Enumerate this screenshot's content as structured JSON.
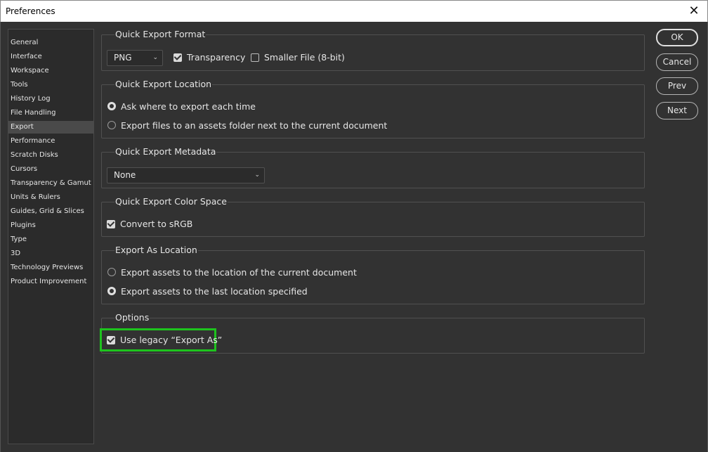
{
  "window": {
    "title": "Preferences",
    "close_glyph": "✕"
  },
  "sidebar": {
    "items": [
      {
        "label": "General"
      },
      {
        "label": "Interface"
      },
      {
        "label": "Workspace"
      },
      {
        "label": "Tools"
      },
      {
        "label": "History Log"
      },
      {
        "label": "File Handling"
      },
      {
        "label": "Export"
      },
      {
        "label": "Performance"
      },
      {
        "label": "Scratch Disks"
      },
      {
        "label": "Cursors"
      },
      {
        "label": "Transparency & Gamut"
      },
      {
        "label": "Units & Rulers"
      },
      {
        "label": "Guides, Grid & Slices"
      },
      {
        "label": "Plugins"
      },
      {
        "label": "Type"
      },
      {
        "label": "3D"
      },
      {
        "label": "Technology Previews"
      },
      {
        "label": "Product Improvement"
      }
    ],
    "active": "Export"
  },
  "quick_export_format": {
    "label": "Quick Export Format",
    "format": "PNG",
    "transparency_label": "Transparency",
    "transparency_checked": true,
    "smaller_file_label": "Smaller File (8-bit)",
    "smaller_file_checked": false
  },
  "quick_export_location": {
    "label": "Quick Export Location",
    "option1": "Ask where to export each time",
    "option2": "Export files to an assets folder next to the current document",
    "selected": 1
  },
  "quick_export_metadata": {
    "label": "Quick Export Metadata",
    "value": "None"
  },
  "quick_export_color_space": {
    "label": "Quick Export Color Space",
    "convert_label": "Convert to sRGB",
    "convert_checked": true
  },
  "export_as_location": {
    "label": "Export As Location",
    "option1": "Export assets to the location of the current document",
    "option2": "Export assets to the last location specified",
    "selected": 2
  },
  "options": {
    "label": "Options",
    "legacy_label": "Use legacy “Export As”",
    "legacy_checked": true,
    "highlight_color": "#1ec31e"
  },
  "buttons": {
    "ok": "OK",
    "cancel": "Cancel",
    "prev": "Prev",
    "next": "Next"
  }
}
